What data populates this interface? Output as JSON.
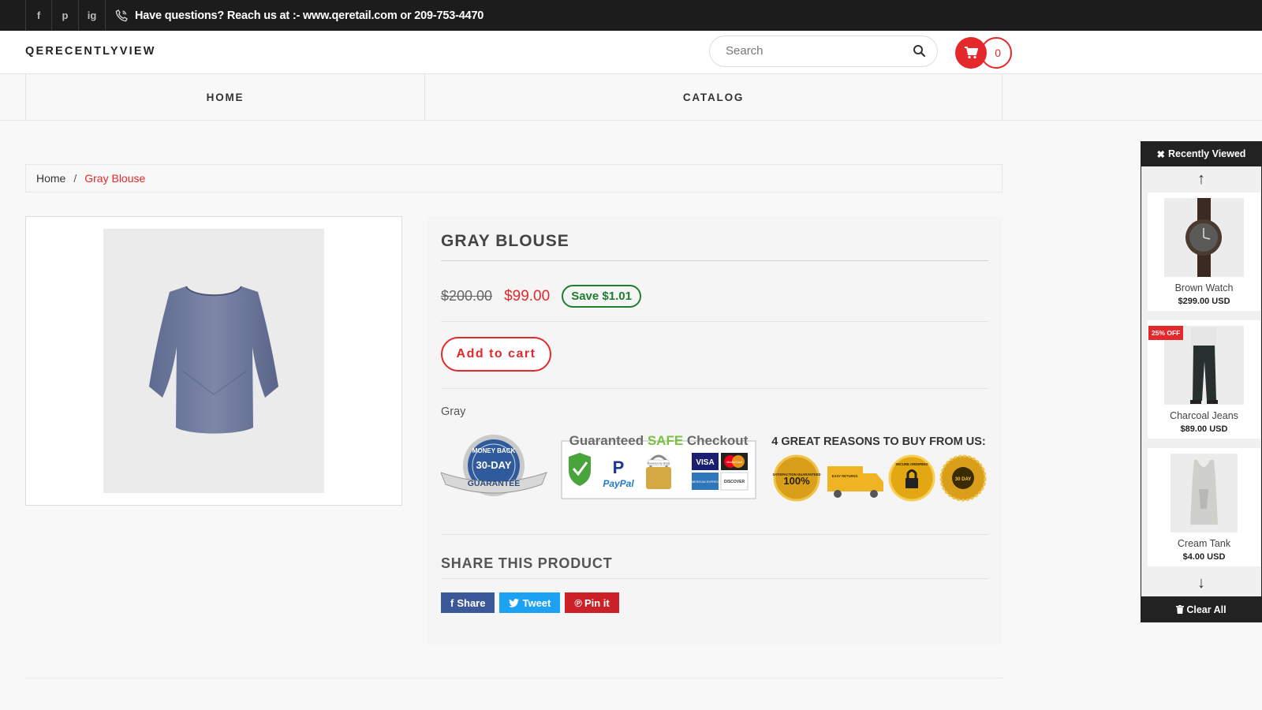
{
  "topbar": {
    "social": [
      "f",
      "p",
      "ig"
    ],
    "message": "Have questions? Reach us at :- www.qeretail.com or 209-753-4470"
  },
  "header": {
    "logo": "QERECENTLYVIEW",
    "search_placeholder": "Search",
    "cart_count": "0"
  },
  "nav": {
    "items": [
      "HOME",
      "CATALOG"
    ]
  },
  "breadcrumb": {
    "home": "Home",
    "separator": "/",
    "current": "Gray Blouse"
  },
  "product": {
    "title": "GRAY BLOUSE",
    "compare_price": "$200.00",
    "price": "$99.00",
    "save": "Save $1.01",
    "add_to_cart": "Add to cart",
    "variant": "Gray"
  },
  "badges": {
    "money_back": [
      "MONEY BACK",
      "30-DAY",
      "GUARANTEE"
    ],
    "checkout_title": "Guaranteed SAFE Checkout",
    "checkout_title_parts": [
      "Guaranteed ",
      "SAFE",
      " Checkout"
    ],
    "checkout_logos": [
      "PayPal",
      "VISA",
      "MasterCard",
      "AMERICAN EXPRESS",
      "DISCOVER",
      "Powered by stripe"
    ],
    "reasons_title": "4 GREAT REASONS TO BUY FROM US:",
    "reasons": [
      "100%",
      "SATISFACTION GUARANTEED",
      "EASY RETURNS",
      "SECURE ORDERING",
      "30 DAY"
    ]
  },
  "share": {
    "title": "SHARE THIS PRODUCT",
    "buttons": [
      "Share",
      "Tweet",
      "Pin it"
    ]
  },
  "recently_viewed": {
    "title": "Recently Viewed",
    "items": [
      {
        "name": "Brown Watch",
        "price": "$299.00 USD"
      },
      {
        "name": "Charcoal Jeans",
        "price": "$89.00 USD",
        "badge": "25% OFF"
      },
      {
        "name": "Cream Tank",
        "price": "$4.00 USD"
      }
    ],
    "clear": "Clear All"
  },
  "colors": {
    "accent": "#e5282b",
    "save_green": "#1e7e2e",
    "dark": "#1c1c1c"
  },
  "icons": [
    "facebook-icon",
    "pinterest-icon",
    "instagram-icon",
    "phone-icon",
    "search-icon",
    "cart-icon",
    "close-icon",
    "arrow-up-icon",
    "arrow-down-icon",
    "trash-icon"
  ]
}
